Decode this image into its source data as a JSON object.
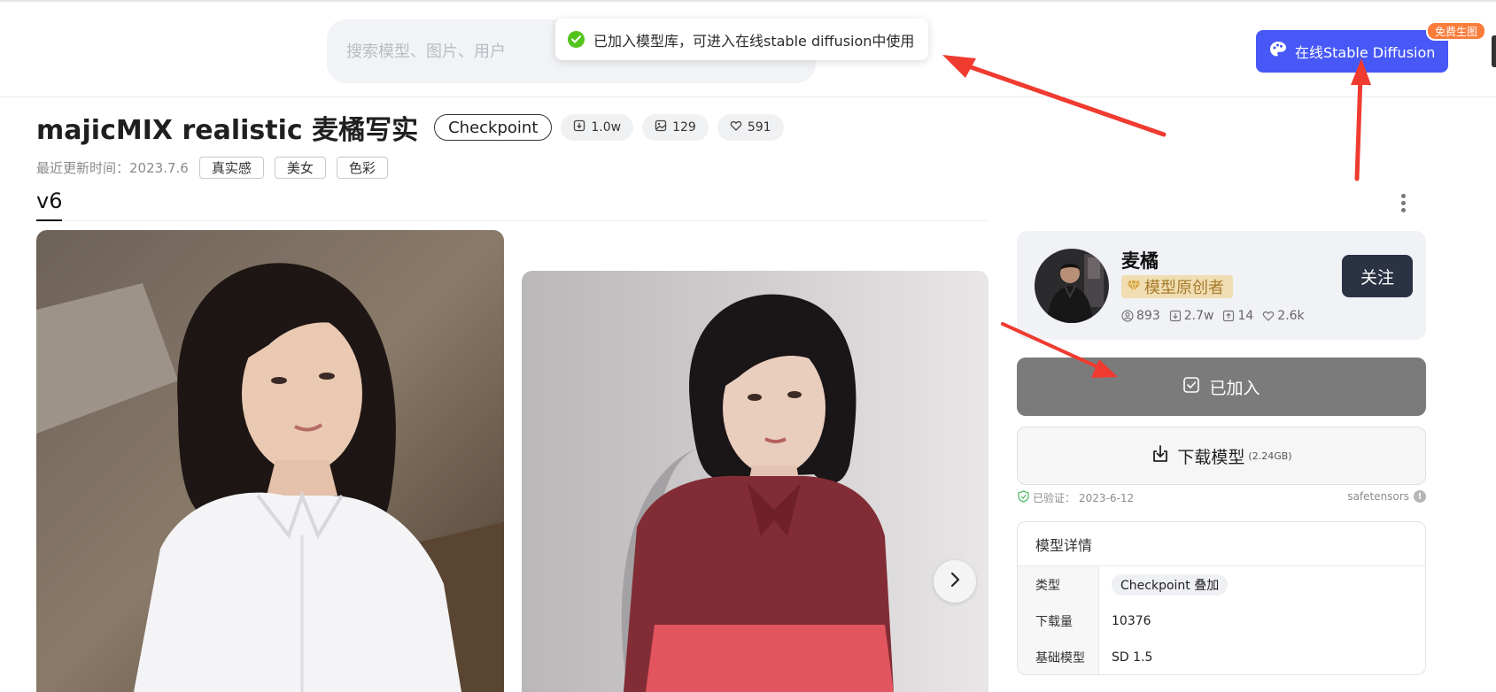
{
  "search": {
    "placeholder": "搜索模型、图片、用户"
  },
  "toast": {
    "message": "已加入模型库，可进入在线stable diffusion中使用",
    "icon": "check-circle-icon"
  },
  "header": {
    "sd_button_label": "在线Stable Diffusion",
    "sd_badge": "免费生图",
    "sd_icon": "palette-icon",
    "accent_color": "#4758f7"
  },
  "model": {
    "title": "majicMIX realistic 麦橘写实",
    "type": "Checkpoint",
    "stats": {
      "downloads": "1.0w",
      "images": "129",
      "likes": "591"
    },
    "updated_label": "最近更新时间：",
    "updated_date": "2023.7.6",
    "tags": [
      "真实感",
      "美女",
      "色彩"
    ],
    "version": "v6"
  },
  "creator": {
    "name": "麦橘",
    "role": "模型原创者",
    "follow_label": "关注",
    "stats": {
      "followers": "893",
      "downloads": "2.7w",
      "uploads": "14",
      "likes": "2.6k"
    }
  },
  "actions": {
    "added_label": "已加入",
    "download_label": "下载模型",
    "download_size": "(2.24GB)"
  },
  "verify": {
    "label": "已验证：",
    "date": "2023-6-12",
    "format": "safetensors"
  },
  "details": {
    "title": "模型详情",
    "rows": [
      {
        "label": "类型",
        "value": "Checkpoint 叠加"
      },
      {
        "label": "下载量",
        "value": "10376"
      },
      {
        "label": "基础模型",
        "value": "SD 1.5"
      }
    ]
  }
}
